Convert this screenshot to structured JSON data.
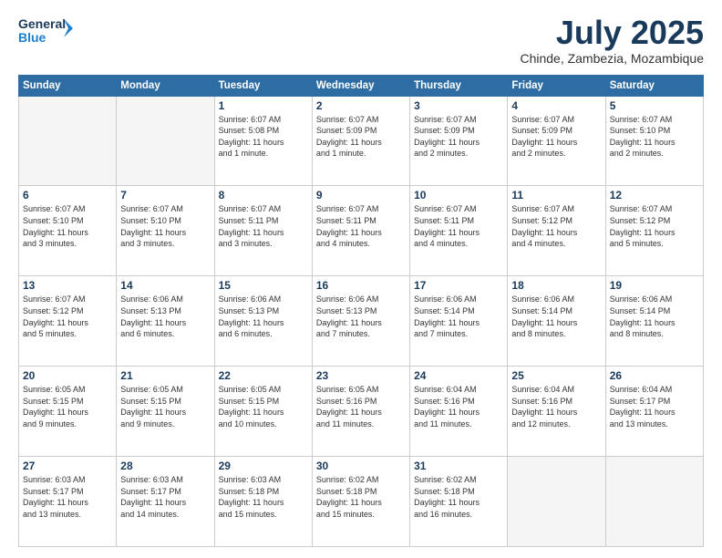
{
  "header": {
    "logo_line1": "General",
    "logo_line2": "Blue",
    "month": "July 2025",
    "location": "Chinde, Zambezia, Mozambique"
  },
  "weekdays": [
    "Sunday",
    "Monday",
    "Tuesday",
    "Wednesday",
    "Thursday",
    "Friday",
    "Saturday"
  ],
  "weeks": [
    [
      {
        "day": "",
        "info": ""
      },
      {
        "day": "",
        "info": ""
      },
      {
        "day": "1",
        "info": "Sunrise: 6:07 AM\nSunset: 5:08 PM\nDaylight: 11 hours\nand 1 minute."
      },
      {
        "day": "2",
        "info": "Sunrise: 6:07 AM\nSunset: 5:09 PM\nDaylight: 11 hours\nand 1 minute."
      },
      {
        "day": "3",
        "info": "Sunrise: 6:07 AM\nSunset: 5:09 PM\nDaylight: 11 hours\nand 2 minutes."
      },
      {
        "day": "4",
        "info": "Sunrise: 6:07 AM\nSunset: 5:09 PM\nDaylight: 11 hours\nand 2 minutes."
      },
      {
        "day": "5",
        "info": "Sunrise: 6:07 AM\nSunset: 5:10 PM\nDaylight: 11 hours\nand 2 minutes."
      }
    ],
    [
      {
        "day": "6",
        "info": "Sunrise: 6:07 AM\nSunset: 5:10 PM\nDaylight: 11 hours\nand 3 minutes."
      },
      {
        "day": "7",
        "info": "Sunrise: 6:07 AM\nSunset: 5:10 PM\nDaylight: 11 hours\nand 3 minutes."
      },
      {
        "day": "8",
        "info": "Sunrise: 6:07 AM\nSunset: 5:11 PM\nDaylight: 11 hours\nand 3 minutes."
      },
      {
        "day": "9",
        "info": "Sunrise: 6:07 AM\nSunset: 5:11 PM\nDaylight: 11 hours\nand 4 minutes."
      },
      {
        "day": "10",
        "info": "Sunrise: 6:07 AM\nSunset: 5:11 PM\nDaylight: 11 hours\nand 4 minutes."
      },
      {
        "day": "11",
        "info": "Sunrise: 6:07 AM\nSunset: 5:12 PM\nDaylight: 11 hours\nand 4 minutes."
      },
      {
        "day": "12",
        "info": "Sunrise: 6:07 AM\nSunset: 5:12 PM\nDaylight: 11 hours\nand 5 minutes."
      }
    ],
    [
      {
        "day": "13",
        "info": "Sunrise: 6:07 AM\nSunset: 5:12 PM\nDaylight: 11 hours\nand 5 minutes."
      },
      {
        "day": "14",
        "info": "Sunrise: 6:06 AM\nSunset: 5:13 PM\nDaylight: 11 hours\nand 6 minutes."
      },
      {
        "day": "15",
        "info": "Sunrise: 6:06 AM\nSunset: 5:13 PM\nDaylight: 11 hours\nand 6 minutes."
      },
      {
        "day": "16",
        "info": "Sunrise: 6:06 AM\nSunset: 5:13 PM\nDaylight: 11 hours\nand 7 minutes."
      },
      {
        "day": "17",
        "info": "Sunrise: 6:06 AM\nSunset: 5:14 PM\nDaylight: 11 hours\nand 7 minutes."
      },
      {
        "day": "18",
        "info": "Sunrise: 6:06 AM\nSunset: 5:14 PM\nDaylight: 11 hours\nand 8 minutes."
      },
      {
        "day": "19",
        "info": "Sunrise: 6:06 AM\nSunset: 5:14 PM\nDaylight: 11 hours\nand 8 minutes."
      }
    ],
    [
      {
        "day": "20",
        "info": "Sunrise: 6:05 AM\nSunset: 5:15 PM\nDaylight: 11 hours\nand 9 minutes."
      },
      {
        "day": "21",
        "info": "Sunrise: 6:05 AM\nSunset: 5:15 PM\nDaylight: 11 hours\nand 9 minutes."
      },
      {
        "day": "22",
        "info": "Sunrise: 6:05 AM\nSunset: 5:15 PM\nDaylight: 11 hours\nand 10 minutes."
      },
      {
        "day": "23",
        "info": "Sunrise: 6:05 AM\nSunset: 5:16 PM\nDaylight: 11 hours\nand 11 minutes."
      },
      {
        "day": "24",
        "info": "Sunrise: 6:04 AM\nSunset: 5:16 PM\nDaylight: 11 hours\nand 11 minutes."
      },
      {
        "day": "25",
        "info": "Sunrise: 6:04 AM\nSunset: 5:16 PM\nDaylight: 11 hours\nand 12 minutes."
      },
      {
        "day": "26",
        "info": "Sunrise: 6:04 AM\nSunset: 5:17 PM\nDaylight: 11 hours\nand 13 minutes."
      }
    ],
    [
      {
        "day": "27",
        "info": "Sunrise: 6:03 AM\nSunset: 5:17 PM\nDaylight: 11 hours\nand 13 minutes."
      },
      {
        "day": "28",
        "info": "Sunrise: 6:03 AM\nSunset: 5:17 PM\nDaylight: 11 hours\nand 14 minutes."
      },
      {
        "day": "29",
        "info": "Sunrise: 6:03 AM\nSunset: 5:18 PM\nDaylight: 11 hours\nand 15 minutes."
      },
      {
        "day": "30",
        "info": "Sunrise: 6:02 AM\nSunset: 5:18 PM\nDaylight: 11 hours\nand 15 minutes."
      },
      {
        "day": "31",
        "info": "Sunrise: 6:02 AM\nSunset: 5:18 PM\nDaylight: 11 hours\nand 16 minutes."
      },
      {
        "day": "",
        "info": ""
      },
      {
        "day": "",
        "info": ""
      }
    ]
  ]
}
